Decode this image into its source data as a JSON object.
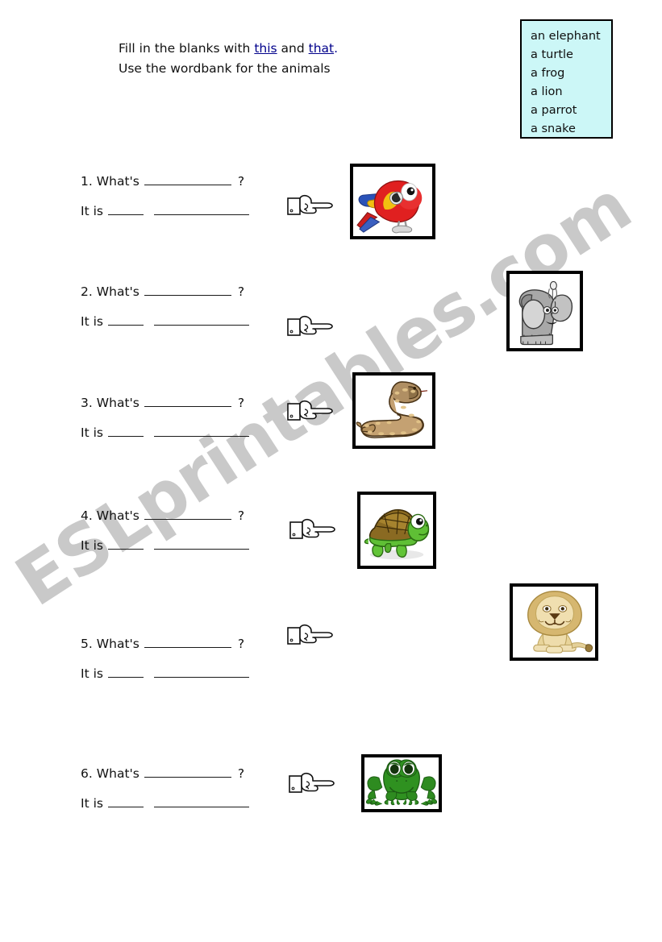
{
  "instructions": {
    "line1_before": "Fill in the blanks with ",
    "keyword1": "this",
    "line1_mid": " and ",
    "keyword2": "that",
    "line1_period": ".",
    "line2": "Use the wordbank for the animals"
  },
  "wordbank": {
    "items": [
      "an elephant",
      "a turtle",
      "a frog",
      "a lion",
      "a parrot",
      "a snake"
    ],
    "background_color": "#ccf7f7",
    "border_color": "#000000"
  },
  "watermark": {
    "text": "ESLprintables.com",
    "color": "#c9c9c9"
  },
  "questions": [
    {
      "number": "1.",
      "whats": "What's",
      "question_mark": "?",
      "it_is": "It is",
      "animal": "a parrot",
      "picture": "parrot-image",
      "distance": "near"
    },
    {
      "number": "2.",
      "whats": "What's",
      "question_mark": "?",
      "it_is": "It is",
      "animal": "an elephant",
      "picture": "elephant-image",
      "distance": "far"
    },
    {
      "number": "3.",
      "whats": "What's",
      "question_mark": "?",
      "it_is": "It is",
      "animal": "a snake",
      "picture": "snake-image",
      "distance": "near"
    },
    {
      "number": "4.",
      "whats": "What's",
      "question_mark": "?",
      "it_is": "It is",
      "animal": "a turtle",
      "picture": "turtle-image",
      "distance": "near"
    },
    {
      "number": "5.",
      "whats": "What's",
      "question_mark": "?",
      "it_is": "It is",
      "animal": "a lion",
      "picture": "lion-image",
      "distance": "far"
    },
    {
      "number": "6.",
      "whats": "What's",
      "question_mark": "?",
      "it_is": "It is",
      "animal": "a frog",
      "picture": "frog-image",
      "distance": "near"
    }
  ],
  "colors": {
    "keyword": "#00008b",
    "text": "#111111",
    "frame": "#000000"
  }
}
